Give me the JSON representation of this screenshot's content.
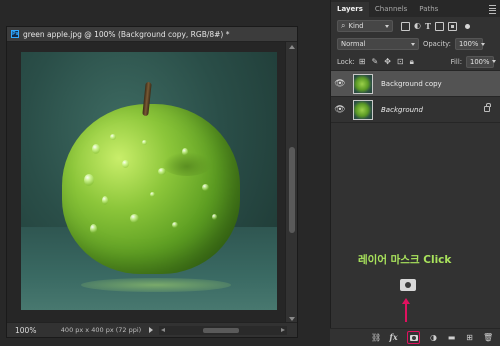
{
  "document": {
    "title": "green apple.jpg @ 100% (Background copy, RGB/8#) *",
    "badge": "Ps",
    "zoom": "100%",
    "info": "400 px x 400 px (72 ppi)"
  },
  "panel": {
    "tabs": [
      "Layers",
      "Channels",
      "Paths"
    ],
    "active_tab": "Layers",
    "filter_kind": "Kind",
    "blend_mode": "Normal",
    "opacity_label": "Opacity:",
    "opacity_value": "100%",
    "lock_label": "Lock:",
    "fill_label": "Fill:",
    "fill_value": "100%",
    "layers": [
      {
        "name": "Background copy",
        "selected": true,
        "visible": true,
        "locked": false
      },
      {
        "name": "Background",
        "selected": false,
        "visible": true,
        "locked": true
      }
    ]
  },
  "annotation": {
    "text": "레이어 마스크 Click"
  },
  "colors": {
    "accent_red": "#e0115f",
    "annotation_green": "#a9e35c"
  }
}
